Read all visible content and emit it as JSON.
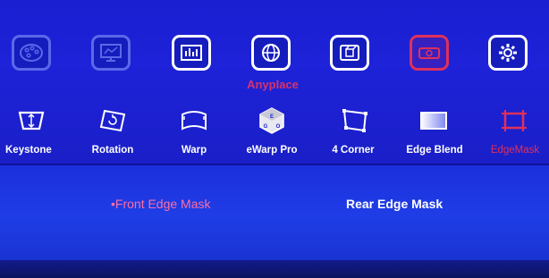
{
  "top_menu": {
    "caption": "Anyplace",
    "items": [
      {
        "icon": "palette-icon"
      },
      {
        "icon": "monitor-icon"
      },
      {
        "icon": "equalizer-icon"
      },
      {
        "icon": "globe-icon"
      },
      {
        "icon": "3d-icon"
      },
      {
        "icon": "projector-icon"
      },
      {
        "icon": "gear-icon"
      }
    ]
  },
  "sub_menu": {
    "items": [
      {
        "label": "Keystone",
        "icon": "keystone-icon"
      },
      {
        "label": "Rotation",
        "icon": "rotation-icon"
      },
      {
        "label": "Warp",
        "icon": "warp-icon"
      },
      {
        "label": "eWarp Pro",
        "icon": "ewarp-pro-icon"
      },
      {
        "label": "4 Corner",
        "icon": "four-corner-icon"
      },
      {
        "label": "Edge Blend",
        "icon": "edge-blend-icon"
      },
      {
        "label": "EdgeMask",
        "icon": "edge-mask-icon"
      }
    ]
  },
  "options": {
    "front": "•Front Edge Mask",
    "rear": "Rear Edge Mask"
  },
  "colors": {
    "panel_blue": "#1e22d8",
    "highlight": "#e0305a",
    "active_text": "#ff6fa3"
  }
}
